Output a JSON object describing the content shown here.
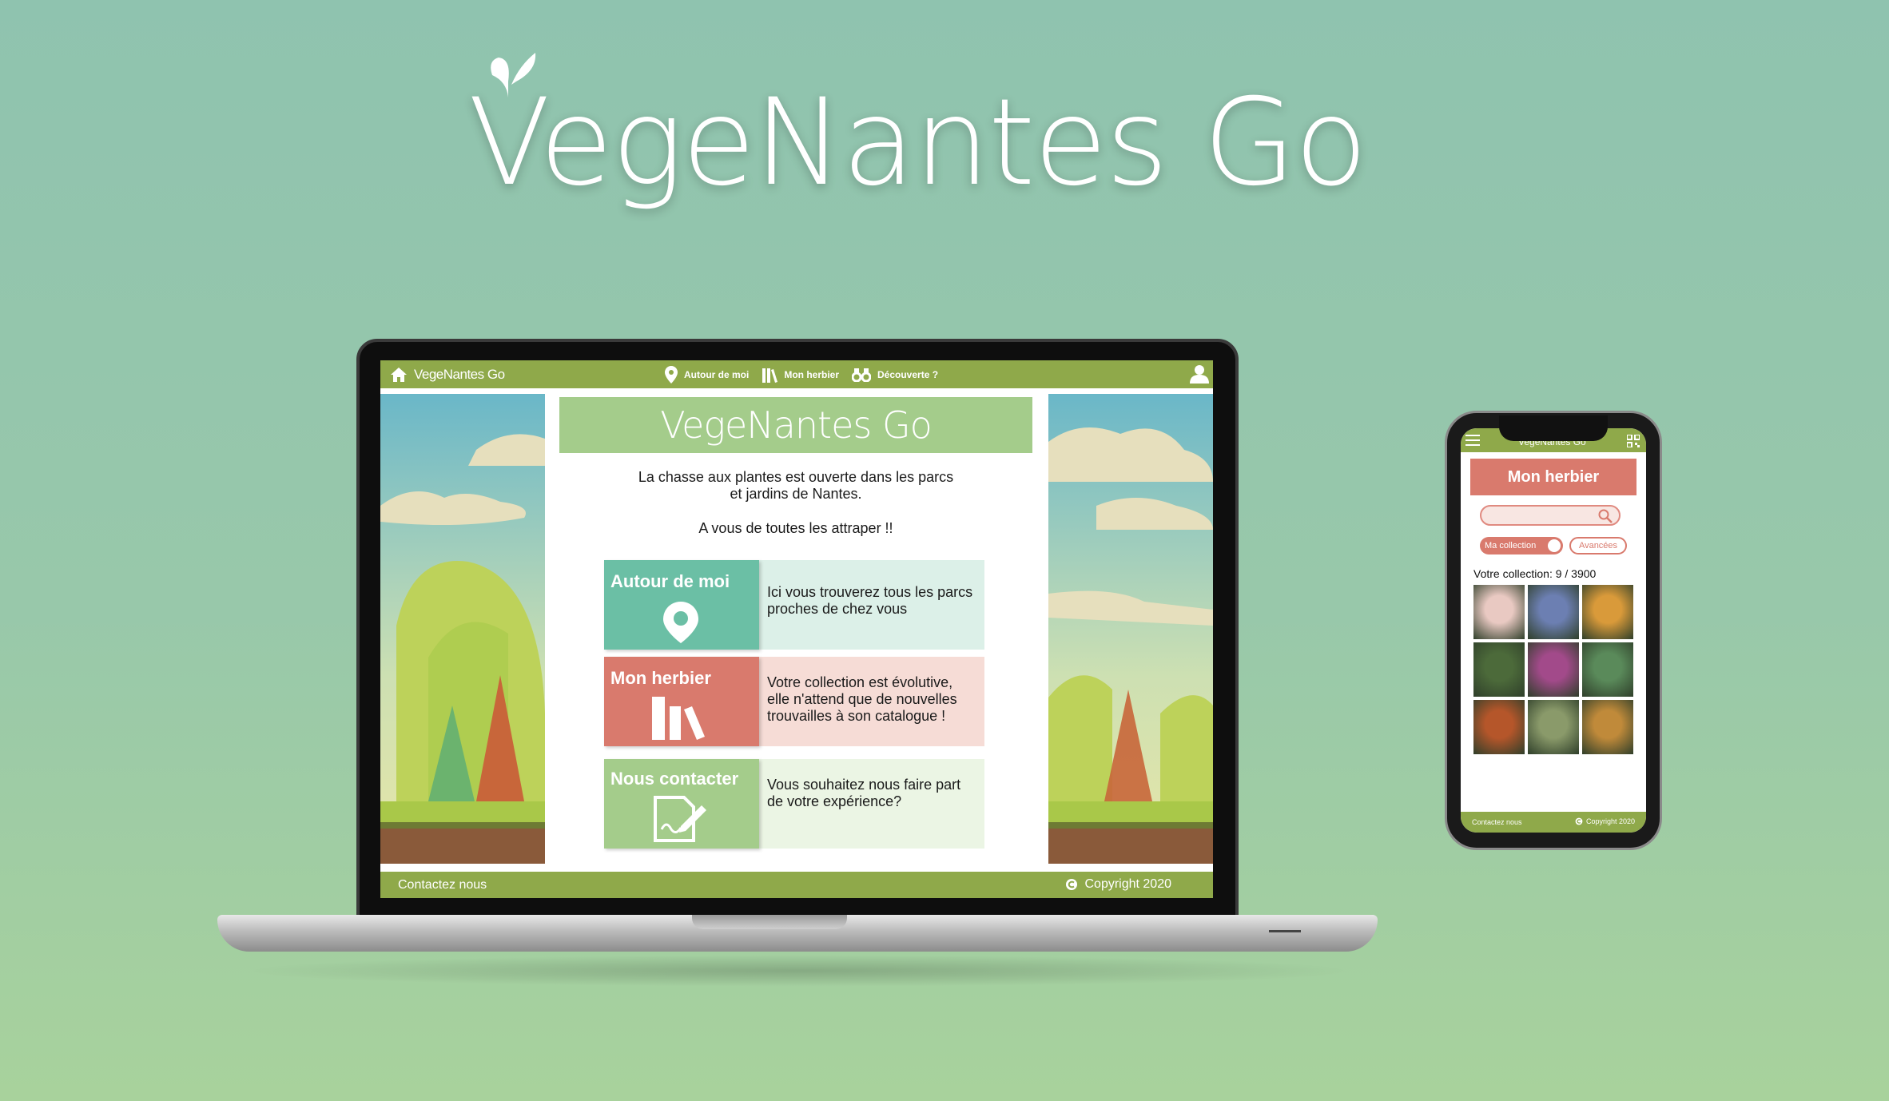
{
  "brand": {
    "title": "VegeNantes Go"
  },
  "web": {
    "nav": {
      "brand": "VegeNantes Go",
      "links": [
        {
          "label": "Autour de moi",
          "icon": "map-pin-icon"
        },
        {
          "label": "Mon herbier",
          "icon": "books-icon"
        },
        {
          "label": "Découverte ?",
          "icon": "binoculars-icon"
        }
      ]
    },
    "banner": "VegeNantes Go",
    "intro_line1": "La chasse aux plantes est ouverte dans les parcs",
    "intro_line2": "et jardins de Nantes.",
    "intro_2": "A vous de toutes les attraper !!",
    "cards": [
      {
        "title": "Autour de moi",
        "desc": "Ici vous trouverez tous les parcs proches de chez vous",
        "icon": "map-pin-icon",
        "color": "#6bbfa5"
      },
      {
        "title": "Mon herbier",
        "desc": "Votre collection est évolutive, elle n'attend que de nouvelles trouvailles à son catalogue !",
        "icon": "books-icon",
        "color": "#d97a6d"
      },
      {
        "title": "Nous contacter",
        "desc": "Vous souhaitez nous faire part de votre expérience?",
        "icon": "contract-edit-icon",
        "color": "#a4cc8b"
      }
    ],
    "footer": {
      "contact": "Contactez nous",
      "copyright": "Copyright 2020"
    }
  },
  "phone": {
    "nav_brand": "VegeNantes Go",
    "title": "Mon herbier",
    "search_placeholder": "",
    "toggle_label": "Ma collection",
    "advanced_label": "Avancées",
    "collection_label": "Votre collection: 9 / 3900",
    "photos": [
      "#e9c9c2",
      "#6c7fb2",
      "#d99a3a",
      "#4c6a3a",
      "#a24a8a",
      "#5a8a5a",
      "#b5562a",
      "#8a9a6a",
      "#c08a3a"
    ],
    "footer": {
      "contact": "Contactez nous",
      "copyright": "Copyright 2020"
    }
  },
  "colors": {
    "nav_green": "#8fa94a",
    "teal": "#6bbfa5",
    "coral": "#d97a6d",
    "light_green": "#a4cc8b"
  }
}
